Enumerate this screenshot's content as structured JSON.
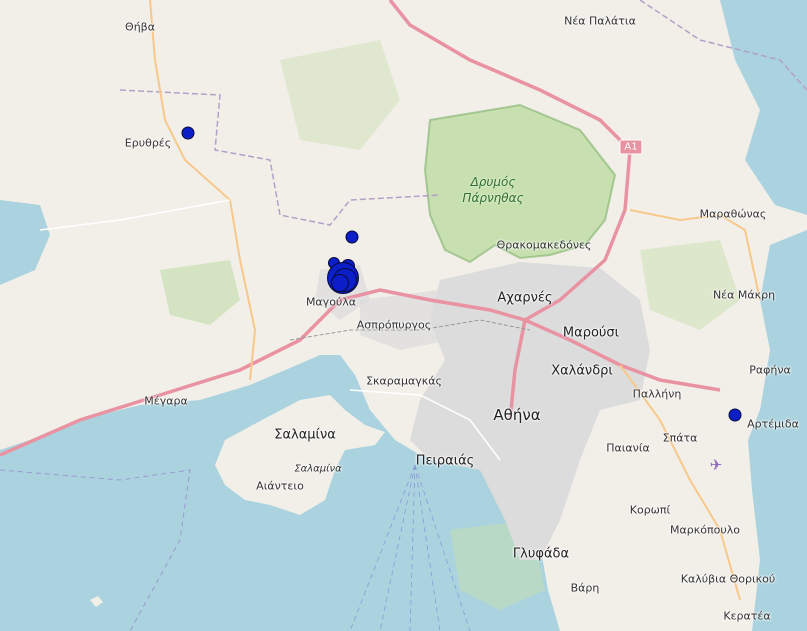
{
  "map": {
    "places": {
      "thiva": "Θήβα",
      "nea_palatia": "Νέα Παλάτια",
      "erythres": "Ερυθρές",
      "drymos_parnithas": "Δρυμός\nΠάρνηθας",
      "thrakomakedones": "Θρακομακεδόνες",
      "marathonas": "Μαραθώνας",
      "acharnes": "Αχαρνές",
      "magoula": "Μαγούλα",
      "aspropyrgos": "Ασπρόπυργος",
      "marousi": "Μαρούσι",
      "nea_makri": "Νέα Μάκρη",
      "chalandri": "Χαλάνδρι",
      "pallini": "Παλλήνη",
      "rafina": "Ραφήνα",
      "megara": "Μέγαρα",
      "skaramangas": "Σκαραμαγκάς",
      "athina": "Αθήνα",
      "artemida": "Αρτέμιδα",
      "salamina_region": "Σαλαμίνα",
      "spata": "Σπάτα",
      "paiania": "Παιανία",
      "salamina_town": "Σαλαμίνα",
      "peiraias": "Πειραιάς",
      "aianteio": "Αιάντειο",
      "koropi": "Κορωπί",
      "markopoulo": "Μαρκόπουλο",
      "glyfada": "Γλυφάδα",
      "vari": "Βάρη",
      "kalyvia": "Καλύβια Θορικού",
      "keratea": "Κερατέα"
    },
    "road_shield": "A1",
    "colors": {
      "sea": "#aad3df",
      "land": "#f2efe9",
      "park": "#c8e0b0",
      "urban": "#dcdcdc",
      "motorway": "#e892a2",
      "marker": "#0b1ec8"
    }
  }
}
